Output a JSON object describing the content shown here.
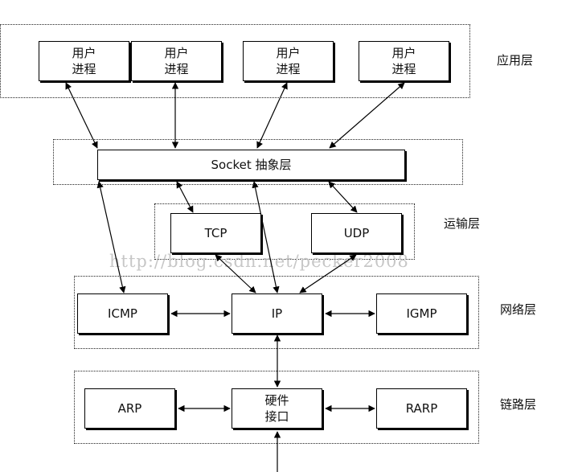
{
  "layers": {
    "application": "应用层",
    "transport": "运输层",
    "network": "网络层",
    "link": "链路层"
  },
  "boxes": {
    "user_process_1": "用户\n进程",
    "user_process_2": "用户\n进程",
    "user_process_3": "用户\n进程",
    "user_process_4": "用户\n进程",
    "socket": "Socket 抽象层",
    "tcp": "TCP",
    "udp": "UDP",
    "icmp": "ICMP",
    "ip": "IP",
    "igmp": "IGMP",
    "arp": "ARP",
    "hardware_interface": "硬件\n接口",
    "rarp": "RARP"
  },
  "watermark": "http://blog.csdn.net/pecker2008"
}
